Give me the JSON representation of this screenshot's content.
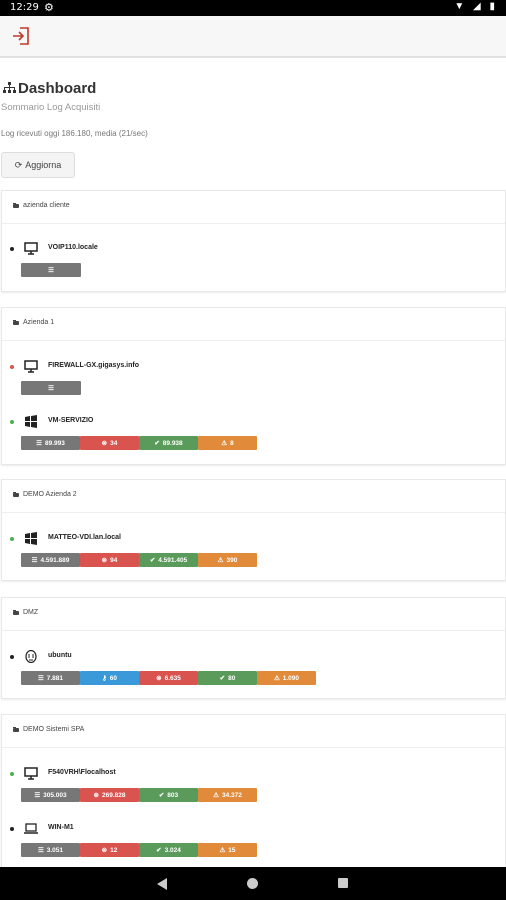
{
  "status_bar": {
    "time": "12:29",
    "system_icons": "▼ ◢ ▮"
  },
  "header": {
    "logout_icon": "logout-icon"
  },
  "dashboard": {
    "title": "Dashboard",
    "subtitle": "Sommario Log Acquisiti",
    "log_info": "Log ricevuti oggi 186.180, media (21/sec)",
    "refresh_label": "Aggiorna"
  },
  "groups": [
    {
      "name": "azienda cliente",
      "hosts": [
        {
          "name": "VOIP110.locale",
          "dot_color": "#222222",
          "icon": "monitor-icon",
          "badges": [
            {
              "color": "grey",
              "icon": "list-icon",
              "value": ""
            }
          ]
        }
      ]
    },
    {
      "name": "Azienda 1",
      "hosts": [
        {
          "name": "FIREWALL-GX.gigasys.info",
          "dot_color": "#d9534f",
          "icon": "monitor-icon",
          "badges": [
            {
              "color": "grey",
              "icon": "list-icon",
              "value": ""
            }
          ]
        },
        {
          "name": "VM-SERVIZIO",
          "dot_color": "#4caf50",
          "icon": "windows-icon",
          "badges": [
            {
              "color": "grey",
              "icon": "list-icon",
              "value": "89.993"
            },
            {
              "color": "red",
              "icon": "error-icon",
              "value": "34"
            },
            {
              "color": "green",
              "icon": "check-icon",
              "value": "89.938"
            },
            {
              "color": "orange",
              "icon": "warning-icon",
              "value": "8"
            }
          ]
        }
      ]
    },
    {
      "name": "DEMO Azienda 2",
      "hosts": [
        {
          "name": "MATTEO-VDI.lan.local",
          "dot_color": "#4caf50",
          "icon": "windows-icon",
          "badges": [
            {
              "color": "grey",
              "icon": "list-icon",
              "value": "4.591.889"
            },
            {
              "color": "red",
              "icon": "error-icon",
              "value": "94"
            },
            {
              "color": "green",
              "icon": "check-icon",
              "value": "4.591.405"
            },
            {
              "color": "orange",
              "icon": "warning-icon",
              "value": "390"
            }
          ]
        }
      ]
    },
    {
      "name": "DMZ",
      "hosts": [
        {
          "name": "ubuntu",
          "dot_color": "#222222",
          "icon": "linux-icon",
          "badges": [
            {
              "color": "grey",
              "icon": "list-icon",
              "value": "7.881"
            },
            {
              "color": "blue",
              "icon": "key-icon",
              "value": "60"
            },
            {
              "color": "red",
              "icon": "error-icon",
              "value": "6.635"
            },
            {
              "color": "green",
              "icon": "check-icon",
              "value": "80"
            },
            {
              "color": "orange",
              "icon": "warning-icon",
              "value": "1.090"
            }
          ]
        }
      ]
    },
    {
      "name": "DEMO Sistemi SPA",
      "hosts": [
        {
          "name": "F540VRH\\Flocalhost",
          "dot_color": "#4caf50",
          "icon": "monitor-icon",
          "badges": [
            {
              "color": "grey",
              "icon": "list-icon",
              "value": "305.003"
            },
            {
              "color": "red",
              "icon": "error-icon",
              "value": "269.828"
            },
            {
              "color": "green",
              "icon": "check-icon",
              "value": "803"
            },
            {
              "color": "orange",
              "icon": "warning-icon",
              "value": "34.372"
            }
          ]
        },
        {
          "name": "WIN-M1",
          "dot_color": "#222222",
          "icon": "laptop-icon",
          "badges": [
            {
              "color": "grey",
              "icon": "list-icon",
              "value": "3.051"
            },
            {
              "color": "red",
              "icon": "error-icon",
              "value": "12"
            },
            {
              "color": "green",
              "icon": "check-icon",
              "value": "3.024"
            },
            {
              "color": "orange",
              "icon": "warning-icon",
              "value": "15"
            }
          ]
        }
      ]
    }
  ]
}
